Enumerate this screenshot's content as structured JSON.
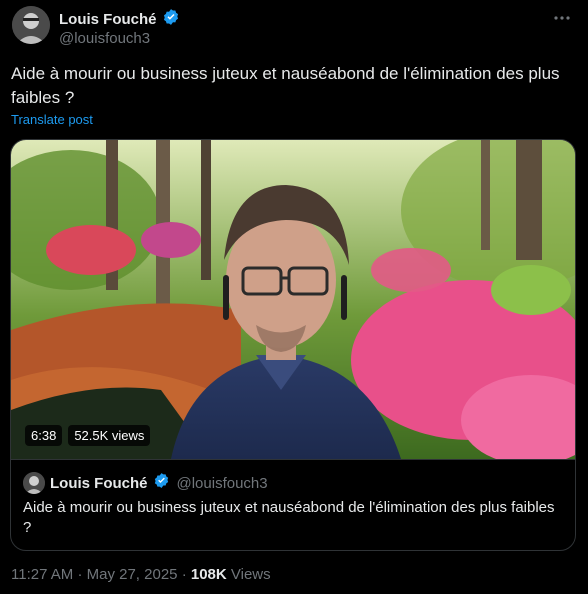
{
  "post": {
    "author": {
      "display_name": "Louis Fouché",
      "handle": "@louisfouch3",
      "verified": true,
      "verified_color": "#1d9bf0"
    },
    "more_icon": "more-horizontal-icon",
    "text": "Aide à mourir ou business juteux et nauséabond de l'élimination des plus faibles ?",
    "translate_label": "Translate post",
    "media": {
      "duration": "6:38",
      "views": "52.5K views"
    },
    "quoted": {
      "display_name": "Louis Fouché",
      "handle": "@louisfouch3",
      "text": "Aide à mourir ou business juteux et nauséabond de l'élimination des plus faibles ?"
    },
    "meta": {
      "time": "11:27 AM",
      "separator": "·",
      "date": "May 27, 2025",
      "views_count": "108K",
      "views_label": "Views"
    }
  }
}
